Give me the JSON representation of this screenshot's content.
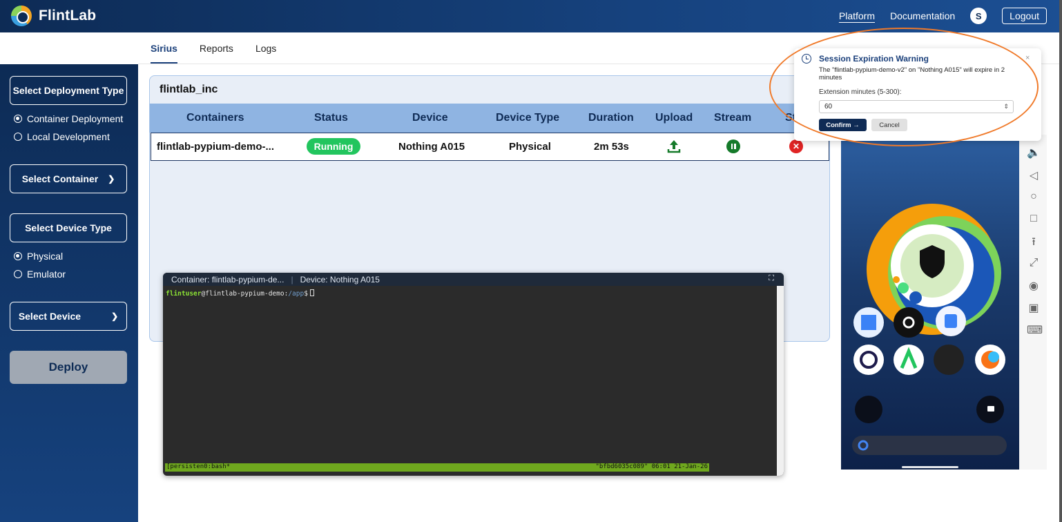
{
  "app": {
    "name": "FlintLab"
  },
  "topnav": {
    "platform": "Platform",
    "documentation": "Documentation",
    "avatar": "S",
    "logout": "Logout"
  },
  "tabs": [
    "Sirius",
    "Reports",
    "Logs"
  ],
  "sidebar": {
    "deployment_type": "Select Deployment Type",
    "deployment_options": [
      "Container Deployment",
      "Local Development"
    ],
    "container": "Select Container",
    "device_type": "Select Device Type",
    "device_type_options": [
      "Physical",
      "Emulator"
    ],
    "device": "Select Device",
    "deploy": "Deploy"
  },
  "panel": {
    "title": "flintlab_inc",
    "headers": [
      "Containers",
      "Status",
      "Device",
      "Device Type",
      "Duration",
      "Upload",
      "Stream",
      "St"
    ],
    "row": {
      "container": "flintlab-pypium-demo-...",
      "status": "Running",
      "device": "Nothing A015",
      "device_type": "Physical",
      "duration": "2m 53s"
    }
  },
  "terminal": {
    "container_label": "Container:",
    "container_value": "flintlab-pypium-de...",
    "device_label": "Device:",
    "device_value": "Nothing A015",
    "prompt_user": "flintuser",
    "prompt_host": "@flintlab-pypium-demo:",
    "prompt_path": "/app",
    "prompt_suffix": "$",
    "status_left": "[persisten0:bash*",
    "status_right": "\"bfbd6035c089\" 06:01 21-Jan-26"
  },
  "warning": {
    "title": "Session Expiration Warning",
    "message": "The \"flintlab-pypium-demo-v2\" on \"Nothing A015\" will expire in 2 minutes",
    "label": "Extension minutes (5-300):",
    "value": "60",
    "confirm": "Confirm →",
    "cancel": "Cancel",
    "close": "×"
  },
  "colors": {
    "navy": "#0d2b55",
    "accent": "#1a3f7a",
    "running": "#22c55e",
    "highlight": "#f07a2a"
  }
}
